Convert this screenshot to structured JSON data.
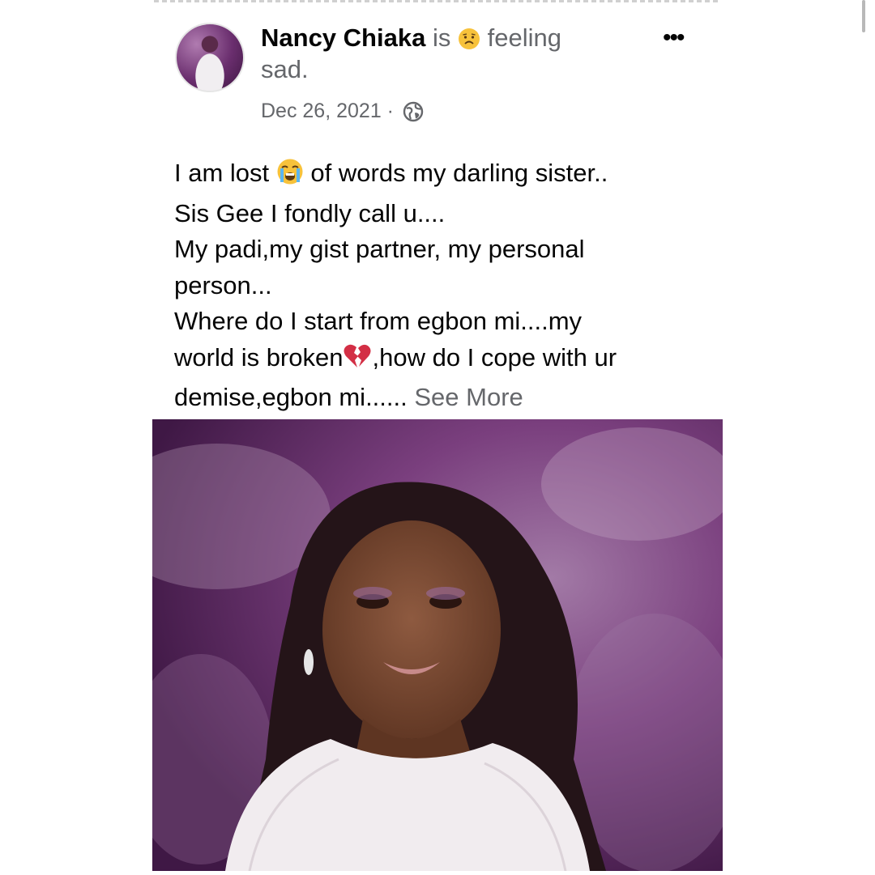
{
  "post": {
    "author": "Nancy Chiaka",
    "status_prefix": "is",
    "feeling_word": "feeling",
    "feeling_value": "sad.",
    "feeling_emoji": "sad-face-icon",
    "date": "Dec 26, 2021",
    "separator": "·",
    "privacy_icon": "globe-icon",
    "more_label": "•••",
    "text_lines": [
      {
        "before": "I am lost",
        "emoji": "loudly-crying-face-icon",
        "after": "of words my darling sister.."
      },
      {
        "text": "Sis Gee I fondly call u...."
      },
      {
        "text": "My padi,my gist partner, my personal"
      },
      {
        "text": "person..."
      },
      {
        "text": "Where do I start from egbon mi....my"
      },
      {
        "before": "world is broken",
        "emoji": "broken-heart-icon",
        "after": ",how do I cope with ur"
      },
      {
        "text": "demise,egbon mi......",
        "see_more": "See More"
      }
    ]
  },
  "colors": {
    "primary_text": "#050505",
    "secondary_text": "#65676b",
    "photo_background": "#6a2e6e",
    "emoji_yellow": "#f7c23b",
    "broken_heart": "#d32f45"
  }
}
